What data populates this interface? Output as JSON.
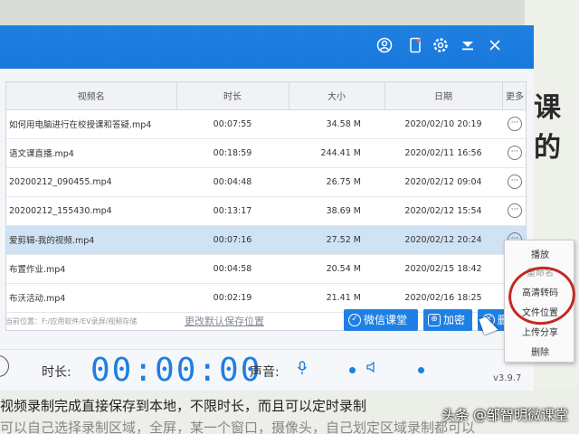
{
  "window": {
    "version": "v3.9.7"
  },
  "titlebar_icons": [
    "user-icon",
    "phone-icon",
    "settings-icon",
    "menu-icon",
    "close-icon"
  ],
  "table": {
    "columns": [
      "视频名",
      "时长",
      "大小",
      "日期",
      "更多"
    ],
    "rows": [
      {
        "name": "如何用电脑进行在校授课和答疑.mp4",
        "duration": "00:07:55",
        "size": "34.58 M",
        "date": "2020/02/10 20:19"
      },
      {
        "name": "语文课直播.mp4",
        "duration": "00:18:59",
        "size": "244.41 M",
        "date": "2020/02/11 16:56"
      },
      {
        "name": "20200212_090455.mp4",
        "duration": "00:04:48",
        "size": "26.75 M",
        "date": "2020/02/12 09:04"
      },
      {
        "name": "20200212_155430.mp4",
        "duration": "00:13:17",
        "size": "38.69 M",
        "date": "2020/02/12 15:54"
      },
      {
        "name": "爱剪辑-我的视频.mp4",
        "duration": "00:07:16",
        "size": "27.52 M",
        "date": "2020/02/12 20:24"
      },
      {
        "name": "布置作业.mp4",
        "duration": "00:04:58",
        "size": "20.54 M",
        "date": "2020/02/15 18:42"
      },
      {
        "name": "布沃活动.mp4",
        "duration": "00:02:19",
        "size": "21.41 M",
        "date": "2020/02/16 18:25"
      }
    ],
    "selected_row_index": 4
  },
  "footer": {
    "path_label": "当前位置：F:/应用软件/EV录屏/视频存储",
    "change_path": "更改默认保存位置",
    "btn_wechat": "微信课堂",
    "btn_encrypt": "加密",
    "btn_third": "删"
  },
  "recorder": {
    "duration_label": "时长:",
    "timer": "00:00:00",
    "sound_label": "声音:"
  },
  "context_menu": {
    "items": [
      "播放",
      "重命名",
      "高清转码",
      "文件位置",
      "上传分享",
      "删除"
    ]
  },
  "background_doc": {
    "right_text": "课的",
    "line1": "视频录制完成直接保存到本地，不限时长，而且可以定时录制",
    "line2": "可以自己选择录制区域，全屏，某一个窗口，摄像头，自己划定区域录制都可以"
  },
  "watermark": "头条 @邹智明微课堂"
}
